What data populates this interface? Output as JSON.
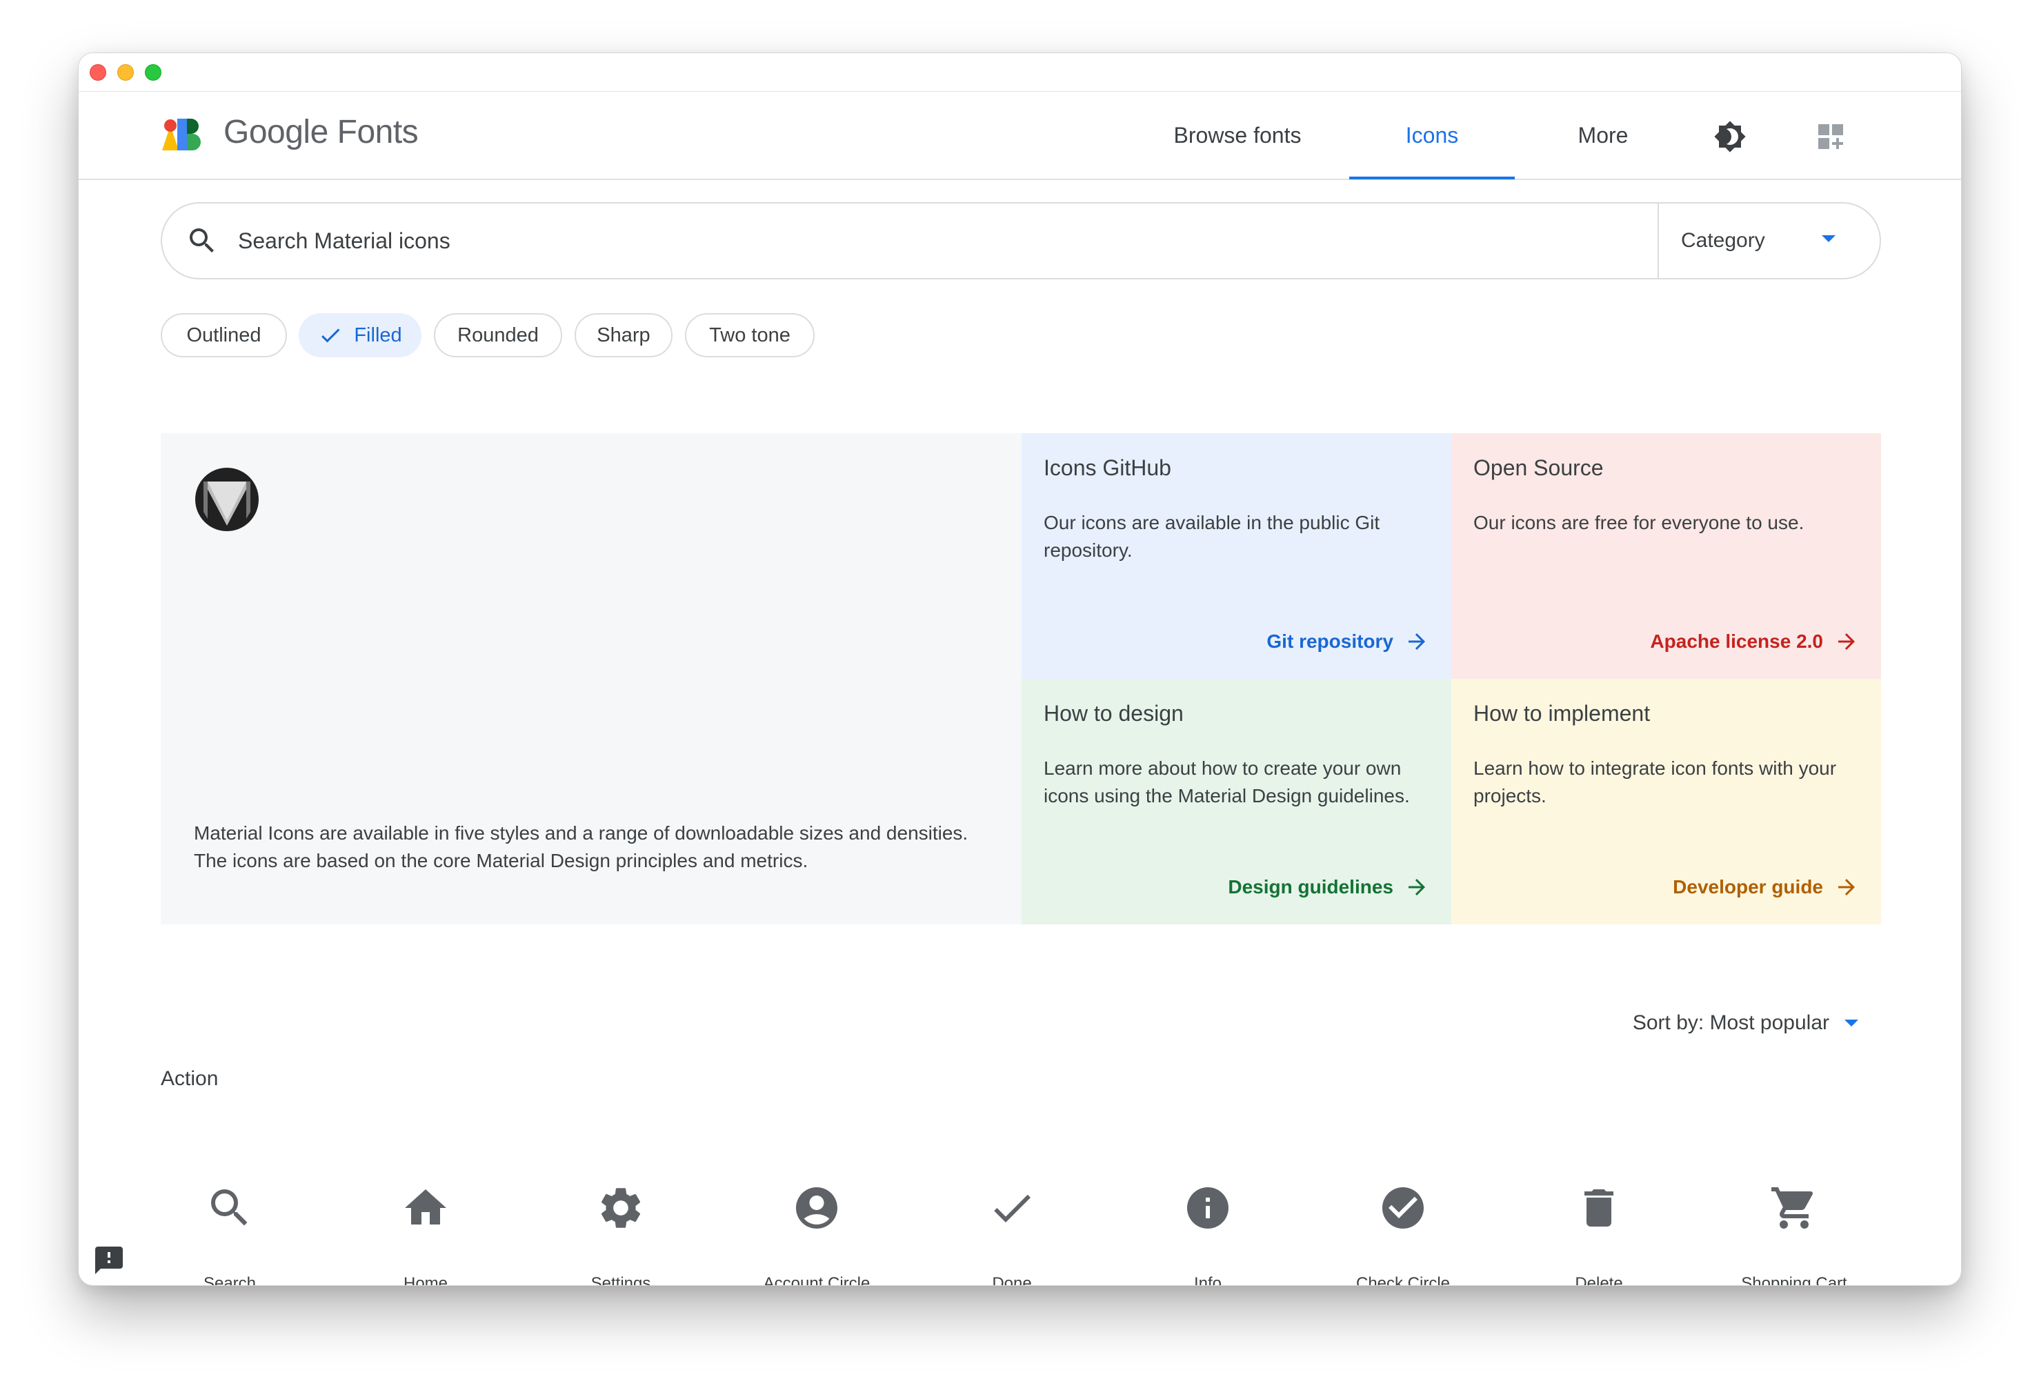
{
  "window": {
    "traffic_lights": [
      "close",
      "minimize",
      "maximize"
    ]
  },
  "header": {
    "brand": "Google Fonts",
    "nav": [
      {
        "label": "Browse fonts",
        "active": false
      },
      {
        "label": "Icons",
        "active": true
      },
      {
        "label": "More",
        "active": false
      }
    ],
    "icons": [
      "brightness-icon",
      "apps-icon"
    ],
    "accent_color": "#1a73e8"
  },
  "search": {
    "placeholder": "Search Material icons",
    "value": "",
    "category_label": "Category"
  },
  "styles": {
    "chips": [
      {
        "label": "Outlined",
        "selected": false
      },
      {
        "label": "Filled",
        "selected": true
      },
      {
        "label": "Rounded",
        "selected": false
      },
      {
        "label": "Sharp",
        "selected": false
      },
      {
        "label": "Two tone",
        "selected": false
      }
    ]
  },
  "hero": {
    "description": "Material Icons are available in five styles and a range of downloadable sizes and densities. The icons are based on the core Material Design principles and metrics.",
    "cards": [
      {
        "title": "Icons GitHub",
        "text": "Our icons are available in the public Git repository.",
        "link": "Git repository",
        "color": "#1967d2",
        "background": "#e8f0fe"
      },
      {
        "title": "Open Source",
        "text": "Our icons are free for everyone to use.",
        "link": "Apache license 2.0",
        "color": "#c5221f",
        "background": "#fce8e6"
      },
      {
        "title": "How to design",
        "text": "Learn more about how to create your own icons using the Material Design guidelines.",
        "link": "Design guidelines",
        "color": "#137333",
        "background": "#e6f4ea"
      },
      {
        "title": "How to implement",
        "text": "Learn how to integrate icon fonts with your projects.",
        "link": "Developer guide",
        "color": "#b06000",
        "background": "#fef7e0"
      }
    ]
  },
  "sort": {
    "label": "Sort by: Most popular"
  },
  "section": {
    "title": "Action"
  },
  "icons": [
    {
      "label": "Search",
      "icon": "search-icon"
    },
    {
      "label": "Home",
      "icon": "home-icon"
    },
    {
      "label": "Settings",
      "icon": "settings-icon"
    },
    {
      "label": "Account Circle",
      "icon": "account-circle-icon"
    },
    {
      "label": "Done",
      "icon": "done-icon"
    },
    {
      "label": "Info",
      "icon": "info-icon"
    },
    {
      "label": "Check Circle",
      "icon": "check-circle-icon"
    },
    {
      "label": "Delete",
      "icon": "delete-icon"
    },
    {
      "label": "Shopping Cart",
      "icon": "shopping-cart-icon"
    }
  ]
}
